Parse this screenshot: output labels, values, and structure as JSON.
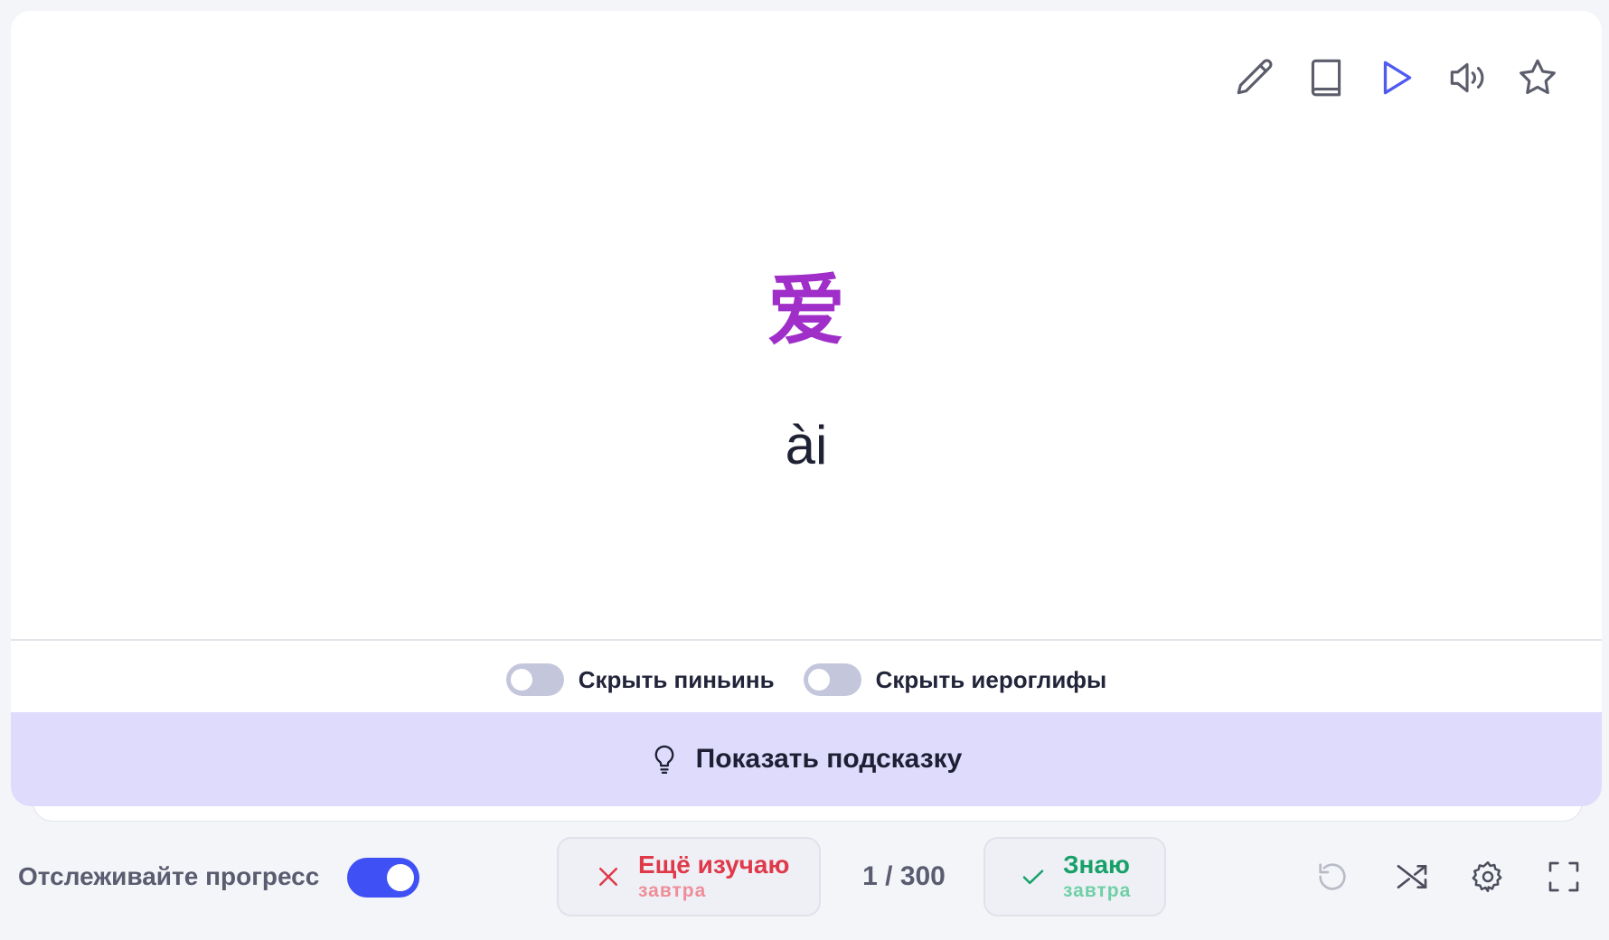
{
  "card": {
    "hanzi": "爱",
    "pinyin": "ài",
    "toolbar_icons": [
      "pencil-icon",
      "book-icon",
      "play-icon",
      "speaker-icon",
      "star-icon"
    ]
  },
  "toggles": {
    "hide_pinyin": {
      "label": "Скрыть пиньинь",
      "on": false
    },
    "hide_hanzi": {
      "label": "Скрыть иероглифы",
      "on": false
    }
  },
  "hint": {
    "label": "Показать подсказку",
    "icon": "lightbulb-icon"
  },
  "bottom": {
    "progress_label": "Отслеживайте прогресс",
    "progress_on": true,
    "still_learning": {
      "label": "Ещё изучаю",
      "sub": "завтра",
      "icon": "close-icon"
    },
    "counter": "1 / 300",
    "know": {
      "label": "Знаю",
      "sub": "завтра",
      "icon": "check-icon"
    },
    "controls": [
      "undo-icon",
      "shuffle-icon",
      "gear-icon",
      "fullscreen-icon"
    ]
  },
  "colors": {
    "hanzi": "#a02fc9",
    "accent": "#3f51f5",
    "hint_bg": "#dedbfc",
    "learning_red": "#e0394a",
    "know_green": "#17a169"
  }
}
